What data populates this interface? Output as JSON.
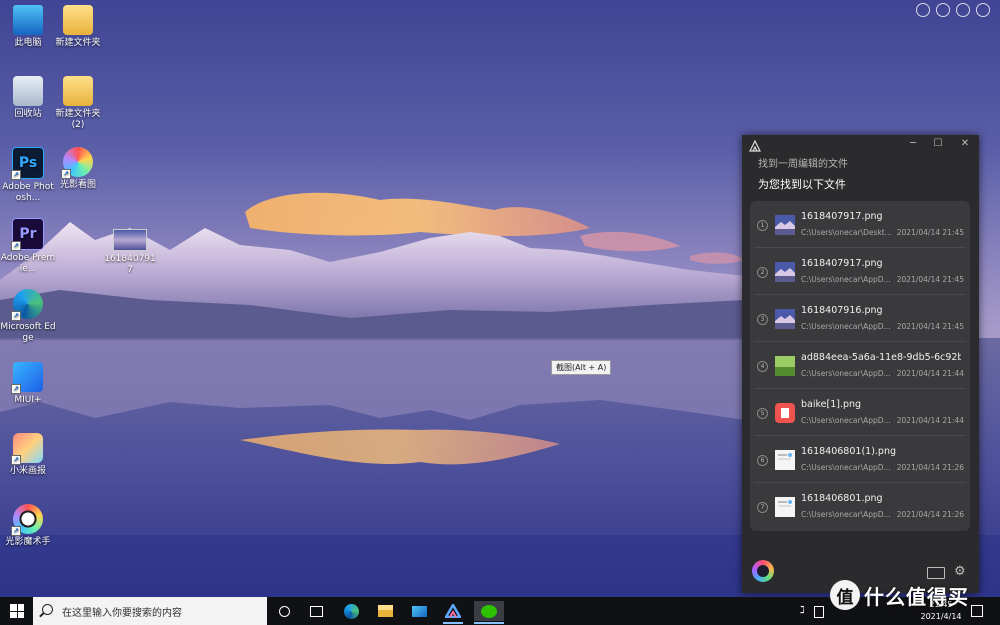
{
  "desktop": {
    "icons": [
      {
        "label": "此电脑",
        "icon": "computer-icon"
      },
      {
        "label": "新建文件夹",
        "icon": "folder-icon"
      },
      {
        "label": "回收站",
        "icon": "recycle-bin-icon"
      },
      {
        "label": "新建文件夹 (2)",
        "icon": "folder-icon"
      },
      {
        "label": "Adobe Photosh...",
        "icon": "photoshop-icon",
        "glyph": "Ps"
      },
      {
        "label": "光影看图",
        "icon": "photo-viewer-icon"
      },
      {
        "label": "Adobe Premie...",
        "icon": "premiere-icon",
        "glyph": "Pr"
      },
      {
        "label": "1618407917",
        "icon": "image-file-icon"
      },
      {
        "label": "Microsoft Edge",
        "icon": "edge-icon"
      },
      {
        "label": "MIUI+",
        "icon": "miui-plus-icon"
      },
      {
        "label": "小米画报",
        "icon": "mi-wallpaper-icon"
      },
      {
        "label": "光影魔术手",
        "icon": "neoimaging-icon"
      }
    ]
  },
  "tooltip": {
    "text": "截图(Alt + A)"
  },
  "panel": {
    "query": "找到一周编辑的文件",
    "heading": "为您找到以下文件",
    "results": [
      {
        "index": "1",
        "name": "1618407917.png",
        "path": "C:\\Users\\onecar\\Deskt...",
        "date": "2021/04/14 21:45",
        "thumb": "landscape"
      },
      {
        "index": "2",
        "name": "1618407917.png",
        "path": "C:\\Users\\onecar\\AppD...",
        "date": "2021/04/14 21:45",
        "thumb": "landscape"
      },
      {
        "index": "3",
        "name": "1618407916.png",
        "path": "C:\\Users\\onecar\\AppD...",
        "date": "2021/04/14 21:45",
        "thumb": "landscape"
      },
      {
        "index": "4",
        "name": "ad884eea-5a6a-11e8-9db5-6c92bf3...",
        "path": "C:\\Users\\onecar\\AppD...",
        "date": "2021/04/14 21:44",
        "thumb": "green"
      },
      {
        "index": "5",
        "name": "baike[1].png",
        "path": "C:\\Users\\onecar\\AppD...",
        "date": "2021/04/14 21:44",
        "thumb": "red"
      },
      {
        "index": "6",
        "name": "1618406801(1).png",
        "path": "C:\\Users\\onecar\\AppD...",
        "date": "2021/04/14 21:26",
        "thumb": "doc"
      },
      {
        "index": "7",
        "name": "1618406801.png",
        "path": "C:\\Users\\onecar\\AppD...",
        "date": "2021/04/14 21:26",
        "thumb": "doc"
      }
    ],
    "window_controls": {
      "minimize": "─",
      "maximize": "☐",
      "close": "✕"
    },
    "colors": {
      "background": "#2b2b2d",
      "list_background": "#3a3a3d"
    }
  },
  "taskbar": {
    "search_placeholder": "在这里输入你要搜索的内容",
    "pinned": [
      "cortana-icon",
      "task-view-icon",
      "edge-icon",
      "file-explorer-icon",
      "mail-icon",
      "xiaoai-icon",
      "wechat-icon"
    ],
    "time": "21:45",
    "date": "2021/4/14"
  },
  "watermark": {
    "badge": "值",
    "text": "什么值得买"
  }
}
